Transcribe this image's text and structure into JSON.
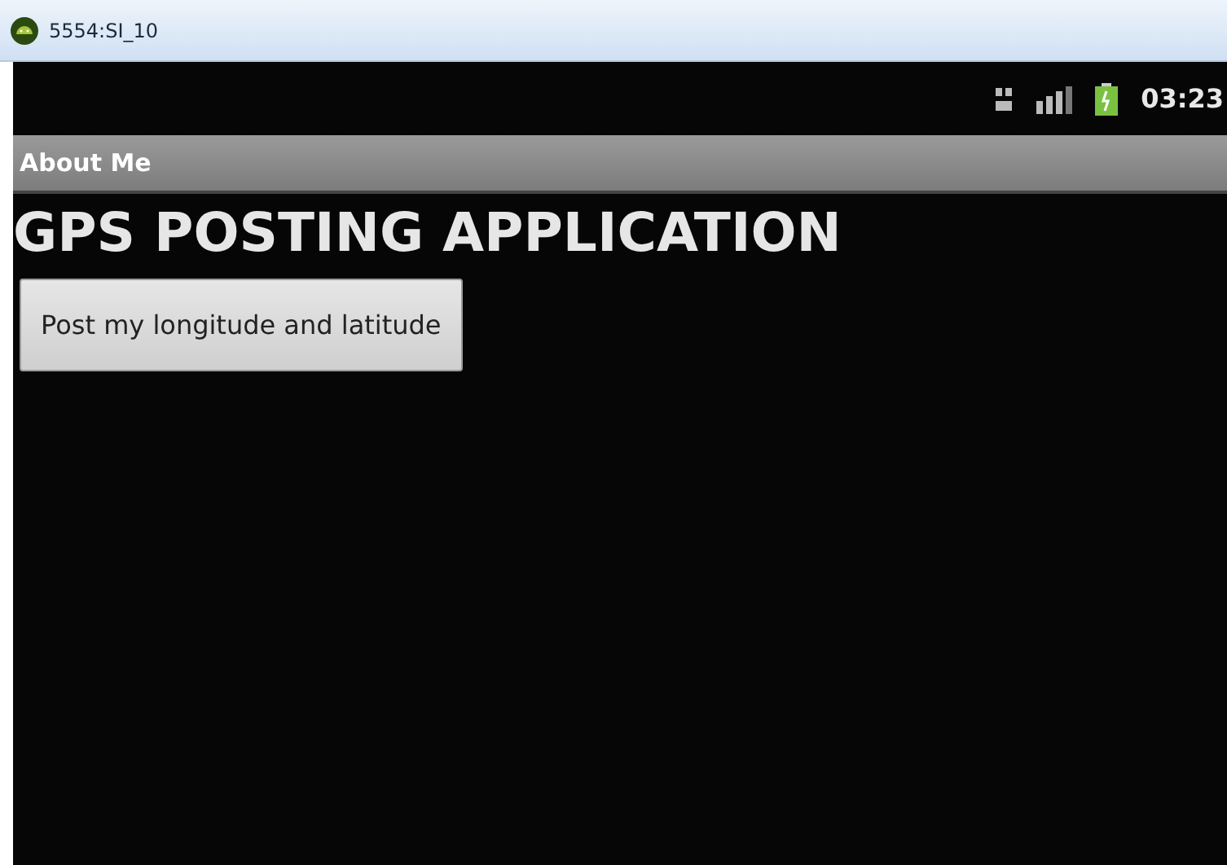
{
  "window": {
    "title": "5554:SI_10"
  },
  "status_bar": {
    "time": "03:23"
  },
  "title_bar": {
    "title": "About Me"
  },
  "content": {
    "heading": "GPS POSTING APPLICATION",
    "button": "Post my longitude and latitude"
  }
}
